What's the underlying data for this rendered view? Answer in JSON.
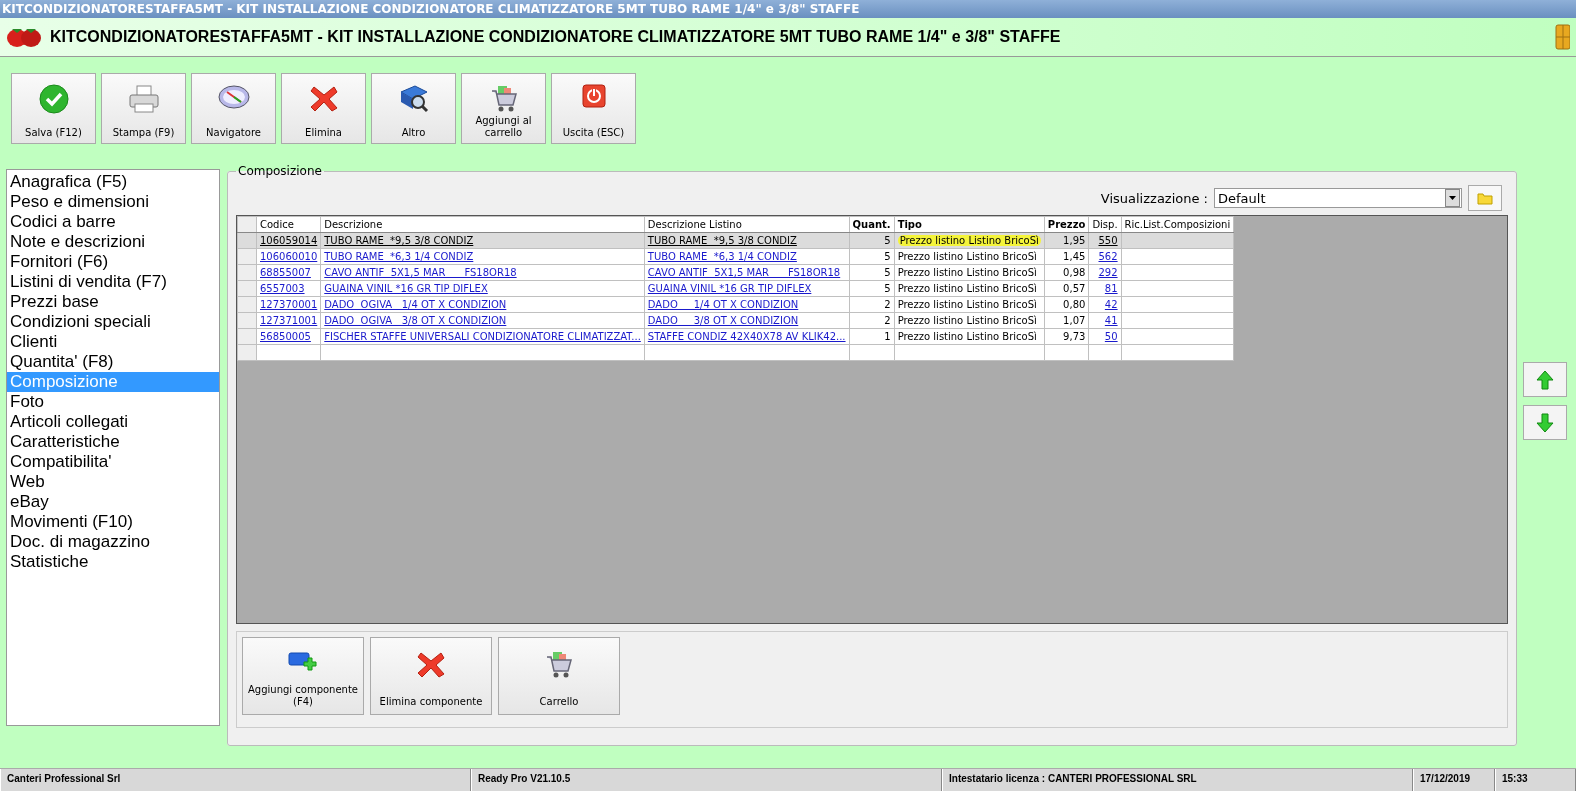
{
  "window": {
    "title": "KITCONDIZIONATORESTAFFA5MT - KIT INSTALLAZIONE CONDIZIONATORE CLIMATIZZATORE 5MT TUBO RAME 1/4\" e 3/8\" STAFFE"
  },
  "header": {
    "title": "KITCONDIZIONATORESTAFFA5MT - KIT INSTALLAZIONE CONDIZIONATORE CLIMATIZZATORE 5MT TUBO RAME 1/4\" e 3/8\" STAFFE"
  },
  "toolbar": [
    {
      "label": "Salva (F12)",
      "kind": "check"
    },
    {
      "label": "Stampa (F9)",
      "kind": "printer"
    },
    {
      "label": "Navigatore",
      "kind": "compass"
    },
    {
      "label": "Elimina",
      "kind": "cross"
    },
    {
      "label": "Altro",
      "kind": "book"
    },
    {
      "label": "Aggiungi al carrello",
      "kind": "cart"
    },
    {
      "label": "Uscita (ESC)",
      "kind": "power"
    }
  ],
  "sidebar": {
    "items": [
      {
        "label": "Anagrafica (F5)",
        "selected": false
      },
      {
        "label": "Peso e dimensioni",
        "selected": false
      },
      {
        "label": "Codici a barre",
        "selected": false
      },
      {
        "label": "Note e descrizioni",
        "selected": false
      },
      {
        "label": "Fornitori (F6)",
        "selected": false
      },
      {
        "label": "Listini di vendita (F7)",
        "selected": false
      },
      {
        "label": "Prezzi base",
        "selected": false
      },
      {
        "label": "Condizioni speciali",
        "selected": false
      },
      {
        "label": "Clienti",
        "selected": false
      },
      {
        "label": "Quantita' (F8)",
        "selected": false
      },
      {
        "label": "Composizione",
        "selected": true
      },
      {
        "label": "Foto",
        "selected": false
      },
      {
        "label": "Articoli collegati",
        "selected": false
      },
      {
        "label": "Caratteristiche",
        "selected": false
      },
      {
        "label": "Compatibilita'",
        "selected": false
      },
      {
        "label": "Web",
        "selected": false
      },
      {
        "label": "eBay",
        "selected": false
      },
      {
        "label": "Movimenti (F10)",
        "selected": false
      },
      {
        "label": "Doc. di magazzino",
        "selected": false
      },
      {
        "label": "Statistiche",
        "selected": false
      }
    ]
  },
  "panel": {
    "title": "Composizione",
    "view_label": "Visualizzazione :",
    "view_value": "Default",
    "table": {
      "columns": [
        {
          "label": "Codice",
          "kind": "link",
          "bold": false
        },
        {
          "label": "Descrizione",
          "kind": "link",
          "bold": false
        },
        {
          "label": "Descrizione Listino",
          "kind": "link",
          "bold": false
        },
        {
          "label": "Quant.",
          "kind": "number",
          "bold": true
        },
        {
          "label": "Tipo",
          "kind": "text",
          "bold": true
        },
        {
          "label": "Prezzo",
          "kind": "number",
          "bold": true
        },
        {
          "label": "Disp.",
          "kind": "linknumber",
          "bold": false
        },
        {
          "label": "Ric.List.Composizioni",
          "kind": "text",
          "bold": false
        }
      ],
      "rows": [
        {
          "selected": true,
          "highlighted": true,
          "cells": [
            "106059014",
            "TUBO RAME  *9,5 3/8 CONDIZ",
            "TUBO RAME  *9,5 3/8 CONDIZ",
            "5",
            "Prezzo listino Listino BricoSì",
            "1,95",
            "550"
          ]
        },
        {
          "selected": false,
          "highlighted": false,
          "cells": [
            "106060010",
            "TUBO RAME  *6,3 1/4 CONDIZ",
            "TUBO RAME  *6,3 1/4 CONDIZ",
            "5",
            "Prezzo listino Listino BricoSì",
            "1,45",
            "562"
          ]
        },
        {
          "selected": false,
          "highlighted": false,
          "cells": [
            "68855007",
            "CAVO ANTIF  5X1,5 MAR      FS18OR18",
            "CAVO ANTIF  5X1,5 MAR      FS18OR18",
            "5",
            "Prezzo listino Listino BricoSì",
            "0,98",
            "292"
          ]
        },
        {
          "selected": false,
          "highlighted": false,
          "cells": [
            "6557003",
            "GUAINA VINIL *16 GR TIP DIFLEX",
            "GUAINA VINIL *16 GR TIP DIFLEX",
            "5",
            "Prezzo listino Listino BricoSì",
            "0,57",
            "81"
          ]
        },
        {
          "selected": false,
          "highlighted": false,
          "cells": [
            "127370001",
            "DADO  OGIVA   1/4 OT X CONDIZION",
            "DADO     1/4 OT X CONDIZION",
            "2",
            "Prezzo listino Listino BricoSì",
            "0,80",
            "42"
          ]
        },
        {
          "selected": false,
          "highlighted": false,
          "cells": [
            "127371001",
            "DADO  OGIVA   3/8 OT X CONDIZION",
            "DADO     3/8 OT X CONDIZION",
            "2",
            "Prezzo listino Listino BricoSì",
            "1,07",
            "41"
          ]
        },
        {
          "selected": false,
          "highlighted": false,
          "cells": [
            "56850005",
            "FISCHER STAFFE UNIVERSALI CONDIZIONATORE CLIMATIZZAT...",
            "STAFFE CONDIZ 42X40X78 AV KLIK42...",
            "1",
            "Prezzo listino Listino BricoSì",
            "9,73",
            "50"
          ]
        }
      ]
    },
    "buttons": [
      {
        "label": "Aggiungi componente (F4)",
        "kind": "add"
      },
      {
        "label": "Elimina componente",
        "kind": "cross"
      },
      {
        "label": "Carrello",
        "kind": "cart"
      }
    ]
  },
  "status_bar": [
    "Canteri Professional Srl",
    "Ready Pro V21.10.5",
    "Intestatario licenza : CANTERI PROFESSIONAL SRL",
    "17/12/2019",
    "15:33"
  ]
}
